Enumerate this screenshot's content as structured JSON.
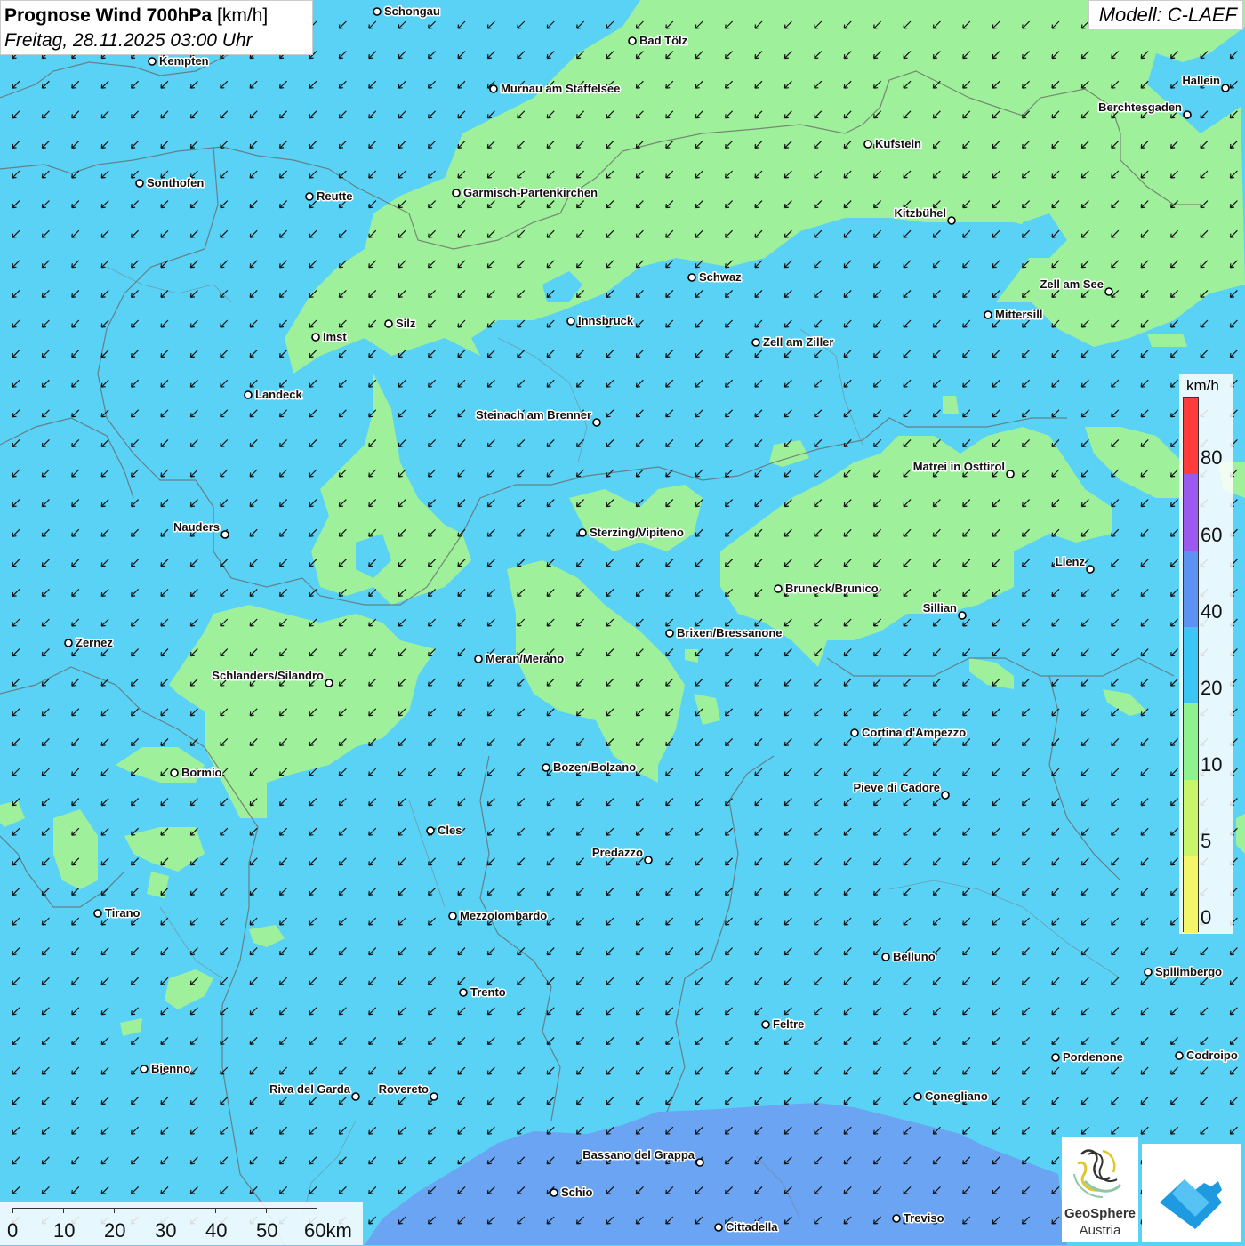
{
  "header": {
    "title_bold": "Prognose Wind 700hPa",
    "title_unit": "[km/h]",
    "datetime": "Freitag, 28.11.2025 03:00 Uhr",
    "model": "Modell: C-LAEF"
  },
  "legend": {
    "unit": "km/h",
    "labels": [
      "80",
      "60",
      "40",
      "20",
      "10",
      "5",
      "0"
    ],
    "colors": [
      "#ff3b3b",
      "#9b59f0",
      "#5c93f3",
      "#3cc6f5",
      "#8ef28e",
      "#c9f56a",
      "#f5f56a"
    ]
  },
  "scale_bar": {
    "labels": [
      "0",
      "10",
      "20",
      "30",
      "40",
      "50",
      "60km"
    ]
  },
  "logos": {
    "geosphere_line1": "GeoSphere",
    "geosphere_line2": "Austria"
  },
  "colors": {
    "wind_10_20": "#9ff09a",
    "wind_20_40": "#5ad2f5",
    "wind_40_60": "#6aa4f2",
    "arrow": "#111111"
  },
  "cities": [
    {
      "name": "Schongau",
      "label_side": "right"
    },
    {
      "name": "Bad Tölz",
      "label_side": "right"
    },
    {
      "name": "Kempten",
      "label_side": "right"
    },
    {
      "name": "Murnau am Staffelsee",
      "label_side": "right"
    },
    {
      "name": "Hallein",
      "label_side": "left"
    },
    {
      "name": "Berchtesgaden",
      "label_side": "left"
    },
    {
      "name": "Kufstein",
      "label_side": "right"
    },
    {
      "name": "Sonthofen",
      "label_side": "right"
    },
    {
      "name": "Reutte",
      "label_side": "right"
    },
    {
      "name": "Garmisch-Partenkirchen",
      "label_side": "right"
    },
    {
      "name": "Kitzbühel",
      "label_side": "left"
    },
    {
      "name": "Schwaz",
      "label_side": "right"
    },
    {
      "name": "Zell am See",
      "label_side": "left"
    },
    {
      "name": "Innsbruck",
      "label_side": "right"
    },
    {
      "name": "Mittersill",
      "label_side": "right"
    },
    {
      "name": "Silz",
      "label_side": "right"
    },
    {
      "name": "Imst",
      "label_side": "right"
    },
    {
      "name": "Zell am Ziller",
      "label_side": "right"
    },
    {
      "name": "Landeck",
      "label_side": "right"
    },
    {
      "name": "Steinach am Brenner",
      "label_side": "left"
    },
    {
      "name": "Matrei in Osttirol",
      "label_side": "left"
    },
    {
      "name": "Nauders",
      "label_side": "left"
    },
    {
      "name": "Sterzing/Vipiteno",
      "label_side": "right"
    },
    {
      "name": "Lienz",
      "label_side": "left"
    },
    {
      "name": "Bruneck/Brunico",
      "label_side": "right"
    },
    {
      "name": "Sillian",
      "label_side": "left"
    },
    {
      "name": "Brixen/Bressanone",
      "label_side": "right"
    },
    {
      "name": "Zernez",
      "label_side": "right"
    },
    {
      "name": "Meran/Merano",
      "label_side": "right"
    },
    {
      "name": "Schlanders/Silandro",
      "label_side": "left"
    },
    {
      "name": "Cortina d'Ampezzo",
      "label_side": "right"
    },
    {
      "name": "Bozen/Bolzano",
      "label_side": "right"
    },
    {
      "name": "Bormio",
      "label_side": "right"
    },
    {
      "name": "Pieve di Cadore",
      "label_side": "left"
    },
    {
      "name": "Cles",
      "label_side": "right"
    },
    {
      "name": "Predazzo",
      "label_side": "left"
    },
    {
      "name": "Tirano",
      "label_side": "right"
    },
    {
      "name": "Mezzolombardo",
      "label_side": "right"
    },
    {
      "name": "Belluno",
      "label_side": "right"
    },
    {
      "name": "Spilimbergo",
      "label_side": "right"
    },
    {
      "name": "Trento",
      "label_side": "right"
    },
    {
      "name": "Feltre",
      "label_side": "right"
    },
    {
      "name": "Pordenone",
      "label_side": "right"
    },
    {
      "name": "Codroipo",
      "label_side": "right"
    },
    {
      "name": "Bienno",
      "label_side": "right"
    },
    {
      "name": "Riva del Garda",
      "label_side": "left"
    },
    {
      "name": "Rovereto",
      "label_side": "left"
    },
    {
      "name": "Conegliano",
      "label_side": "right"
    },
    {
      "name": "Bassano del Grappa",
      "label_side": "left"
    },
    {
      "name": "Schio",
      "label_side": "right"
    },
    {
      "name": "Treviso",
      "label_side": "right"
    },
    {
      "name": "Cittadella",
      "label_side": "right"
    }
  ]
}
